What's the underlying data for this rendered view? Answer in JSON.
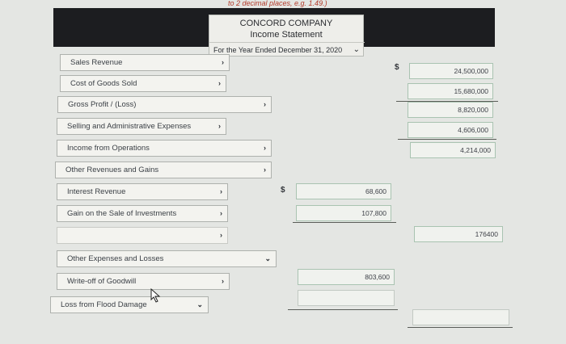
{
  "instruction_fragment": "to 2 decimal places, e.g. 1.49.)",
  "header": {
    "company": "CONCORD COMPANY",
    "statement": "Income Statement",
    "period": "For the Year Ended December 31, 2020"
  },
  "rows": {
    "sales_revenue": "Sales Revenue",
    "cost_of_goods_sold": "Cost of Goods Sold",
    "gross_profit": "Gross Profit / (Loss)",
    "selling_admin": "Selling and Administrative Expenses",
    "income_from_operations": "Income from Operations",
    "other_revenues": "Other Revenues and Gains",
    "interest_revenue": "Interest Revenue",
    "gain_on_sale": "Gain on the Sale of Investments",
    "other_expenses": "Other Expenses and Losses",
    "write_off_goodwill": "Write-off of Goodwill",
    "loss_flood": "Loss from Flood Damage"
  },
  "values": {
    "sales_revenue": "24,500,000",
    "cost_of_goods_sold": "15,680,000",
    "gross_profit": "8,820,000",
    "selling_admin": "4,606,000",
    "income_from_operations": "4,214,000",
    "interest_revenue": "68,600",
    "gain_on_sale": "107,800",
    "other_total": "176400",
    "write_off_goodwill": "803,600"
  },
  "currency_symbol": "$",
  "colors": {
    "header_bg": "#1c1d20",
    "page_bg": "#e4e6e3",
    "instruction": "#b33a2a"
  }
}
